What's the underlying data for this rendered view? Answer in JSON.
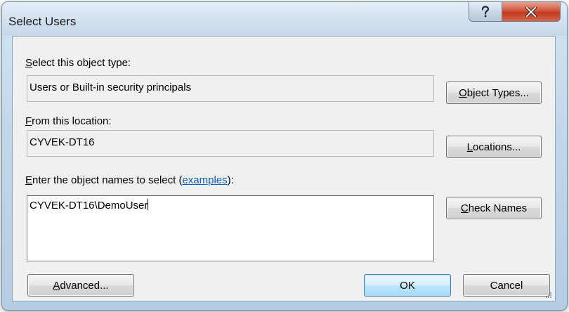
{
  "window": {
    "title": "Select Users"
  },
  "title_buttons": {
    "help_icon": "question-mark-icon",
    "close_icon": "close-x-icon"
  },
  "object_type": {
    "label_accel": "S",
    "label_rest": "elect this object type:",
    "value": "Users or Built-in security principals",
    "button_accel": "O",
    "button_rest": "bject Types..."
  },
  "location": {
    "label_accel": "F",
    "label_rest": "rom this location:",
    "value": "CYVEK-DT16",
    "button_accel": "L",
    "button_rest": "ocations..."
  },
  "names": {
    "label_accel": "E",
    "label_rest": "nter the object names to select (",
    "label_link": "examples",
    "label_end": "):",
    "value": "CYVEK-DT16\\DemoUser",
    "check_accel": "C",
    "check_rest": "heck Names"
  },
  "footer": {
    "advanced_accel": "A",
    "advanced_rest": "dvanced...",
    "ok_label": "OK",
    "cancel_label": "Cancel"
  },
  "colors": {
    "link": "#0b5ec0",
    "close_button": "#c13a1f",
    "ok_border": "#3c7fb1"
  }
}
